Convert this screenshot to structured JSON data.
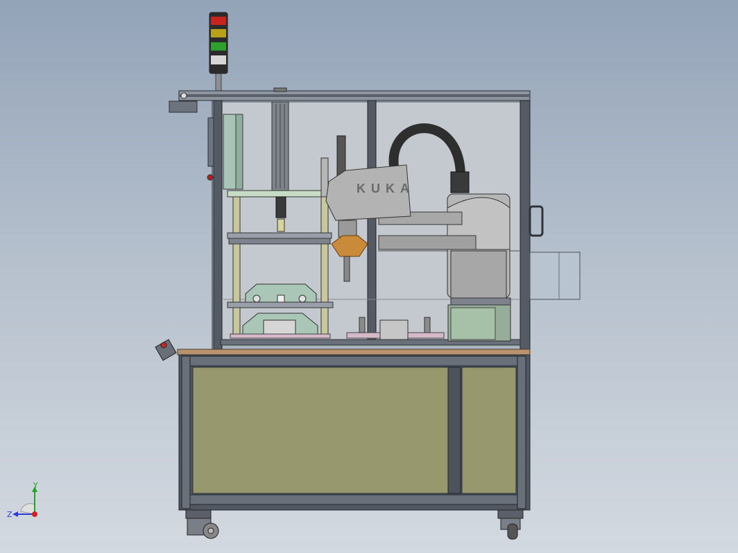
{
  "viewport": {
    "background_top": "#93a3b8",
    "background_bottom": "#d3d9e0"
  },
  "machine": {
    "robot_logo_text": "KUKA",
    "frame_color": "#3c4350",
    "lower_panel_color": "#98986f",
    "upper_plate_color": "#c6d8c6",
    "robot_color": "#b6b6b6",
    "cable_color": "#2e2e2e"
  },
  "signal_tower": {
    "colors": [
      "#c8241f",
      "#b8a21a",
      "#2ea02e",
      "#d6d6d6"
    ]
  },
  "triad": {
    "x_label": "",
    "y_label": "Y",
    "z_label": "Z",
    "x_color": "#d62020",
    "y_color": "#1fa61f",
    "z_color": "#2f3fd6"
  }
}
